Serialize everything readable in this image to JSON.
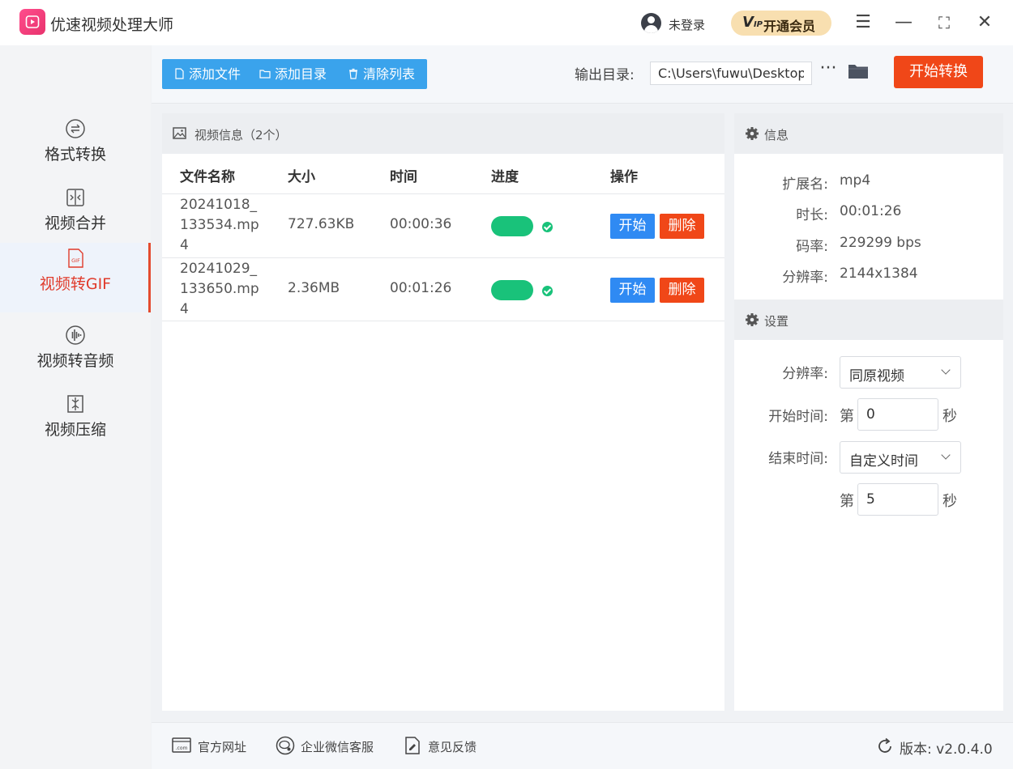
{
  "app": {
    "title": "优速视频处理大师"
  },
  "titlebar": {
    "user_label": "未登录",
    "vip_mark": "V",
    "vip_mark_sub": "IP",
    "vip_label": "开通会员",
    "menu_glyph": "☰",
    "minimize_glyph": "—",
    "maximize_glyph": "⛶",
    "close_glyph": "✕"
  },
  "sidebar": {
    "items": [
      {
        "label": "格式转换",
        "icon": "convert-icon",
        "active": false
      },
      {
        "label": "视频合并",
        "icon": "merge-icon",
        "active": false
      },
      {
        "label": "视频转GIF",
        "icon": "gif-icon",
        "active": true
      },
      {
        "label": "视频转音频",
        "icon": "audio-icon",
        "active": false
      },
      {
        "label": "视频压缩",
        "icon": "compress-icon",
        "active": false
      }
    ]
  },
  "toolbar": {
    "add_file": "添加文件",
    "add_folder": "添加目录",
    "clear_list": "清除列表",
    "output_label": "输出目录:",
    "output_path": "C:\\Users\\fuwu\\Desktop\\",
    "more_glyph": "···",
    "start_button": "开始转换"
  },
  "file_list": {
    "header": "视频信息（2个）",
    "columns": [
      "文件名称",
      "大小",
      "时间",
      "进度",
      "操作"
    ],
    "rows": [
      {
        "name": "20241018_133534.mp4",
        "size": "727.63KB",
        "time": "00:00:36",
        "progress": 1.0,
        "start": "开始",
        "delete": "删除"
      },
      {
        "name": "20241029_133650.mp4",
        "size": "2.36MB",
        "time": "00:01:26",
        "progress": 1.0,
        "start": "开始",
        "delete": "删除"
      }
    ]
  },
  "info": {
    "title": "信息",
    "ext_label": "扩展名:",
    "ext": "mp4",
    "duration_label": "时长:",
    "duration": "00:01:26",
    "bitrate_label": "码率:",
    "bitrate": "229299 bps",
    "resolution_label": "分辨率:",
    "resolution": "2144x1384"
  },
  "settings": {
    "title": "设置",
    "resolution_label": "分辨率:",
    "resolution_value": "同原视频",
    "start_label": "开始时间:",
    "start_prefix": "第",
    "start_value": "0",
    "start_suffix": "秒",
    "end_label": "结束时间:",
    "end_mode": "自定义时间",
    "end_prefix": "第",
    "end_value": "5",
    "end_suffix": "秒"
  },
  "status": {
    "website": "官方网址",
    "wechat": "企业微信客服",
    "feedback": "意见反馈",
    "version": "版本:  v2.0.4.0"
  },
  "colors": {
    "accent_blue": "#3aa3ec",
    "start_red": "#f04718",
    "progress_green": "#19c27a",
    "active_red": "#e03b2b"
  }
}
